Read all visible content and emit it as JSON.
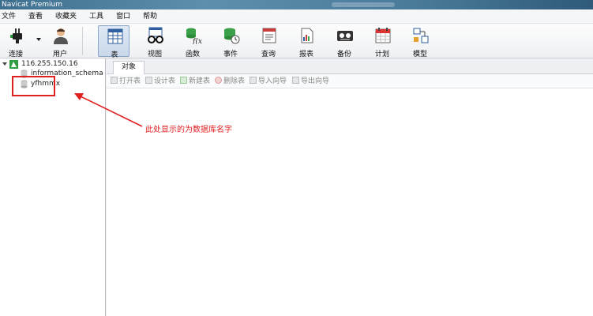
{
  "window": {
    "title": "Navicat Premium"
  },
  "menu": [
    "文件",
    "查看",
    "收藏夹",
    "工具",
    "窗口",
    "帮助"
  ],
  "toolbar": {
    "connect": "连接",
    "user": "用户",
    "table": "表",
    "view": "视图",
    "function": "函数",
    "event": "事件",
    "query": "查询",
    "report": "报表",
    "backup": "备份",
    "schedule": "计划",
    "model": "模型"
  },
  "tree": {
    "connection": "116.255.150.16",
    "databases": [
      "information_schema",
      "yfhmmx"
    ]
  },
  "tabs": {
    "objects": "对象"
  },
  "subtoolbar": {
    "open_table": "打开表",
    "design_table": "设计表",
    "new_table": "新建表",
    "delete_table": "删除表",
    "import_wizard": "导入向导",
    "export_wizard": "导出向导"
  },
  "annotation": {
    "text": "此处显示的为数据库名字",
    "color": "#e02020"
  }
}
